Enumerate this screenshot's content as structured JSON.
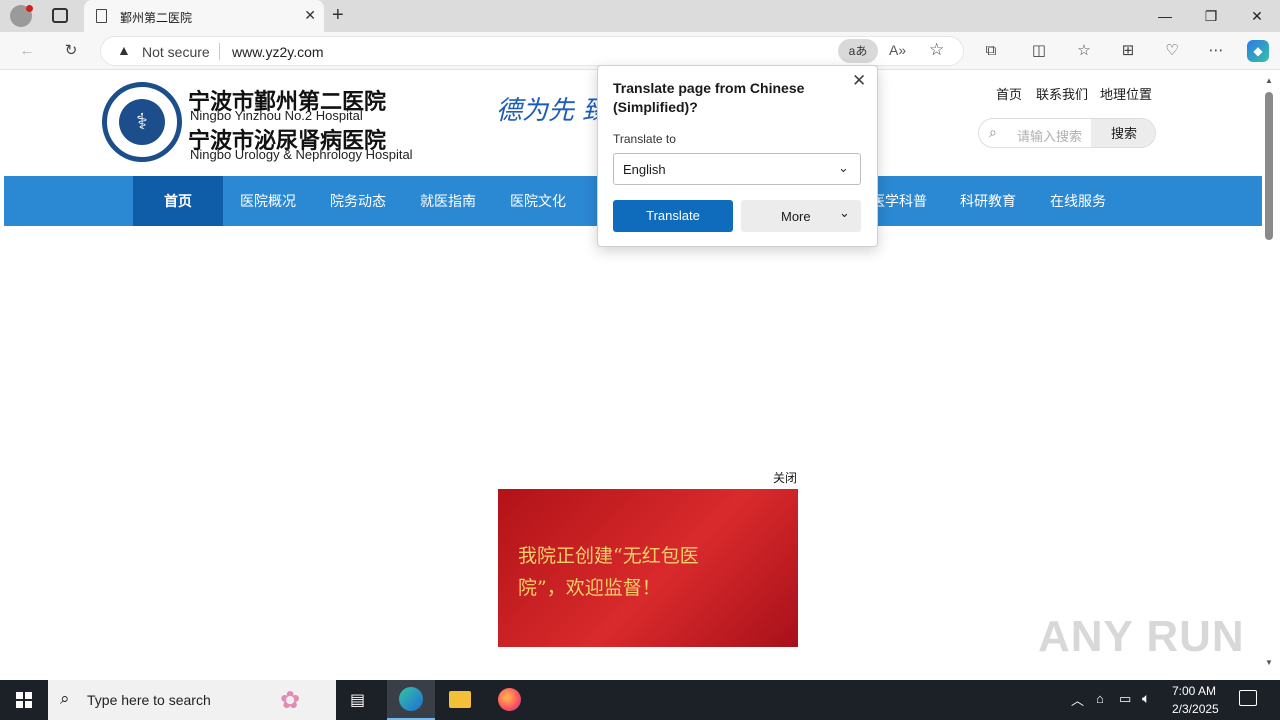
{
  "browser": {
    "tab_title": "鄞州第二医院",
    "address": {
      "security_label": "Not secure",
      "url": "www.yz2y.com"
    }
  },
  "site": {
    "name_cn_1": "宁波市鄞州第二医院",
    "name_en_1": "Ningbo Yinzhou No.2 Hospital",
    "name_cn_2": "宁波市泌尿肾病医院",
    "name_en_2": "Ningbo Urology & Nephrology Hospital",
    "calligraphy": "德为先 臻",
    "top_links": [
      "首页",
      "联系我们",
      "地理位置"
    ],
    "search": {
      "placeholder": "请输入搜索",
      "button": "搜索"
    },
    "nav": [
      "首页",
      "医院概况",
      "院务动态",
      "就医指南",
      "医院文化",
      "",
      "",
      "医学科普",
      "科研教育",
      "在线服务"
    ],
    "popup_ad": {
      "close_label": "关闭",
      "text_line1": "我院正创建“无红包医",
      "text_line2": "院”，欢迎监督！"
    }
  },
  "translate_popup": {
    "title_line1": "Translate page from Chinese",
    "title_line2": "(Simplified)?",
    "to_label": "Translate to",
    "language": "English",
    "translate_button": "Translate",
    "more_button": "More"
  },
  "taskbar": {
    "search_placeholder": "Type here to search",
    "time": "7:00 AM",
    "date": "2/3/2025"
  },
  "watermark": "ANY RUN",
  "colors": {
    "nav_blue": "#2b88d3",
    "nav_active": "#0f5ca9",
    "accent": "#0f6cbd",
    "ad_red": "#c4161c"
  }
}
